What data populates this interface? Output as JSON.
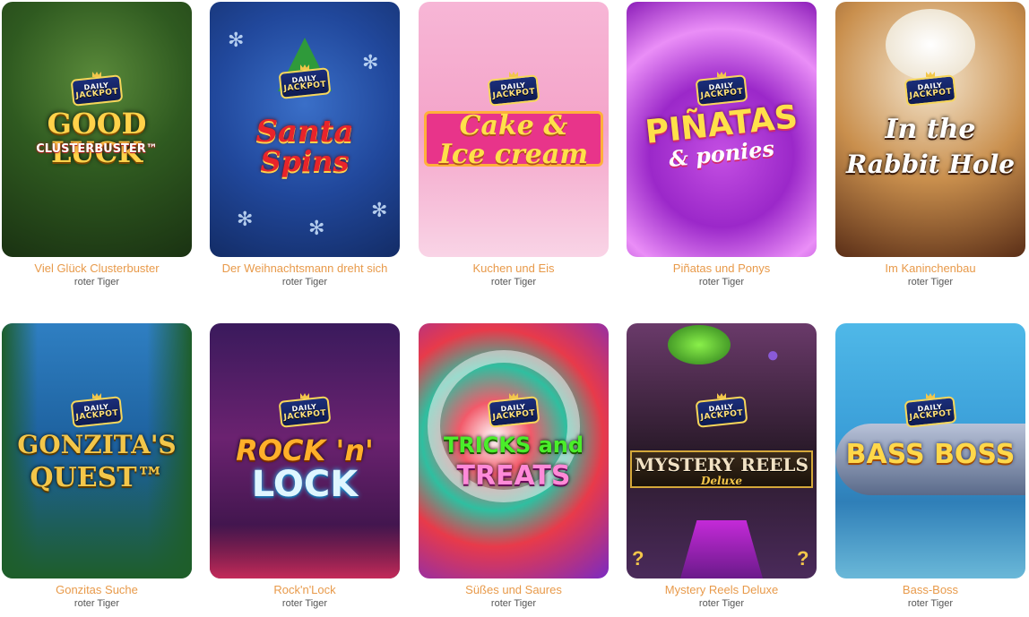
{
  "badge": {
    "line1": "DAILY",
    "line2": "JACKPOT"
  },
  "games": [
    {
      "title": "Viel Glück Clusterbuster",
      "provider": "roter Tiger",
      "logo1": "GOOD LUCK",
      "logo2": "CLUSTERBUSTER™"
    },
    {
      "title": "Der Weihnachtsmann dreht sich",
      "provider": "roter Tiger",
      "logo1": "Santa",
      "logo2": "Spins"
    },
    {
      "title": "Kuchen und Eis",
      "provider": "roter Tiger",
      "logo1": "Cake &",
      "logo2": "Ice cream"
    },
    {
      "title": "Piñatas und Ponys",
      "provider": "roter Tiger",
      "logo1": "PIÑATAS",
      "logo2": "& ponies"
    },
    {
      "title": "Im Kaninchenbau",
      "provider": "roter Tiger",
      "logo1": "In the",
      "logo2": "Rabbit Hole"
    },
    {
      "title": "Gonzitas Suche",
      "provider": "roter Tiger",
      "logo1": "GONZITA'S",
      "logo2": "QUEST™"
    },
    {
      "title": "Rock'n'Lock",
      "provider": "roter Tiger",
      "logo1": "ROCK 'n'",
      "logo2": "LOCK"
    },
    {
      "title": "Süßes und Saures",
      "provider": "roter Tiger",
      "logo1": "TRICKS and",
      "logo2": "TREATS"
    },
    {
      "title": "Mystery Reels Deluxe",
      "provider": "roter Tiger",
      "logo1": "MYSTERY REELS",
      "logo2": "Deluxe"
    },
    {
      "title": "Bass-Boss",
      "provider": "roter Tiger",
      "logo1": "BASS BOSS",
      "logo2": ""
    }
  ]
}
